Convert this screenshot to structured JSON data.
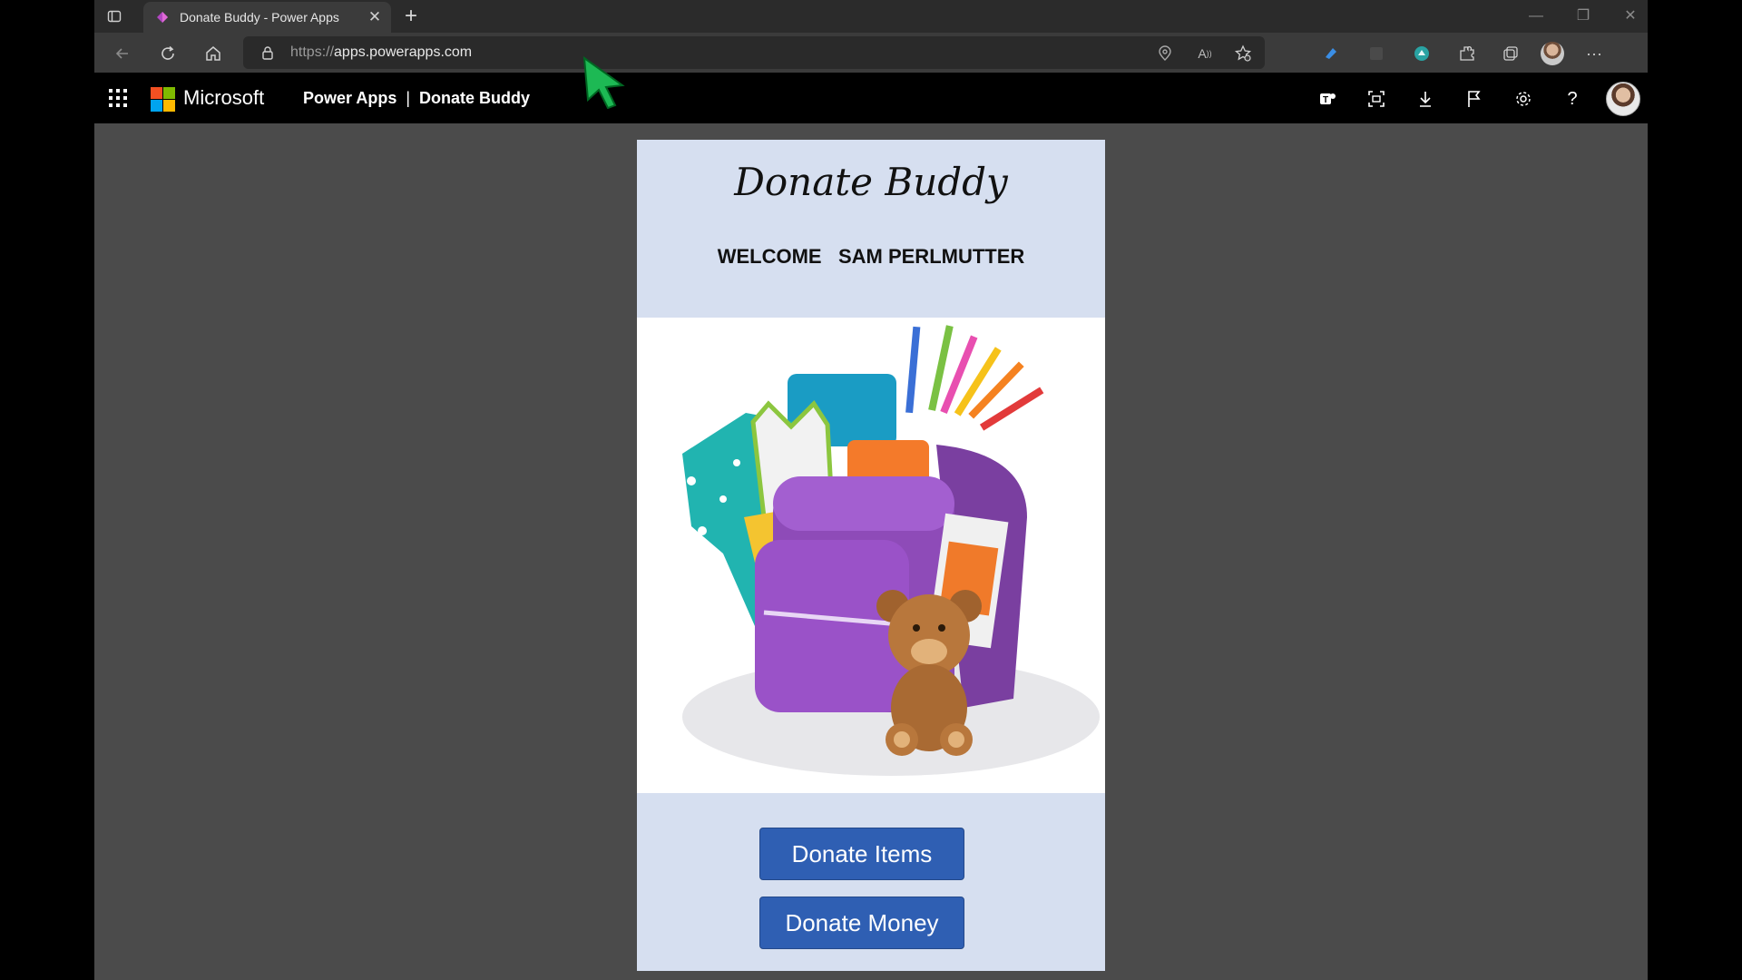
{
  "browser": {
    "tab": {
      "title": "Donate Buddy - Power Apps"
    },
    "address": {
      "protocol": "https://",
      "host": "apps.powerapps.com"
    },
    "window_controls": {
      "minimize": "—",
      "restore": "❐",
      "close": "✕"
    }
  },
  "ms_header": {
    "brand": "Microsoft",
    "app": "Power Apps",
    "separator": "|",
    "item": "Donate Buddy"
  },
  "app": {
    "title": "Donate Buddy",
    "welcome_prefix": "WELCOME",
    "user_name": "SAM PERLMUTTER",
    "buttons": {
      "donate_items": "Donate Items",
      "donate_money": "Donate Money"
    }
  },
  "colors": {
    "canvas_bg": "#d6dff0",
    "button": "#2f5fb3",
    "cursor": "#1db954",
    "ms_red": "#f25022",
    "ms_green": "#7fba00",
    "ms_blue": "#00a4ef",
    "ms_yellow": "#ffb900"
  }
}
